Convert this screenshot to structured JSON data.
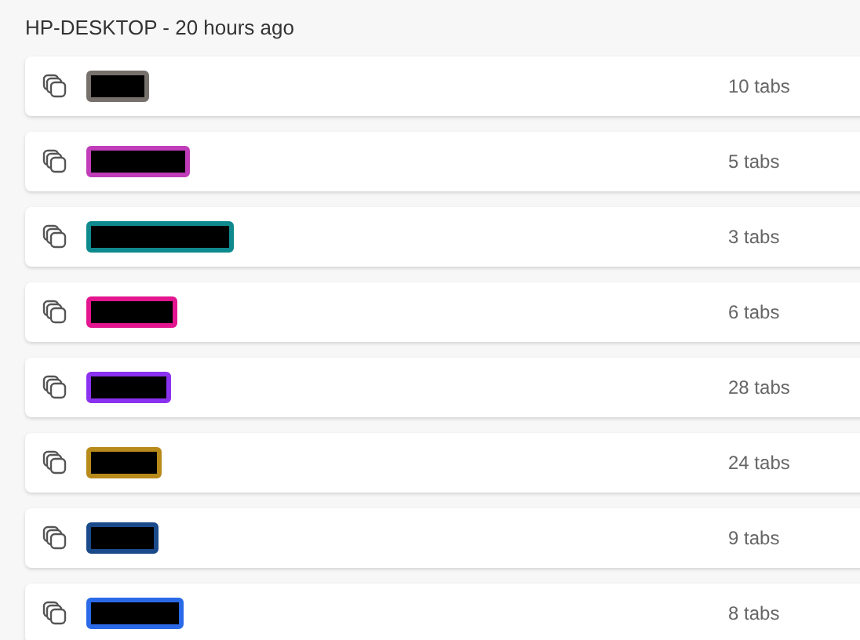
{
  "device_header": "HP-DESKTOP - 20 hours ago",
  "tab_groups": [
    {
      "color": "#77716c",
      "count": "10 tabs"
    },
    {
      "color": "#c03cb8",
      "count": "5 tabs"
    },
    {
      "color": "#0e8a8e",
      "count": "3 tabs"
    },
    {
      "color": "#e3158f",
      "count": "6 tabs"
    },
    {
      "color": "#8a32f0",
      "count": "28 tabs"
    },
    {
      "color": "#b88a1a",
      "count": "24 tabs"
    },
    {
      "color": "#1a4a8a",
      "count": "9 tabs"
    },
    {
      "color": "#2a6ae8",
      "count": "8 tabs"
    }
  ]
}
